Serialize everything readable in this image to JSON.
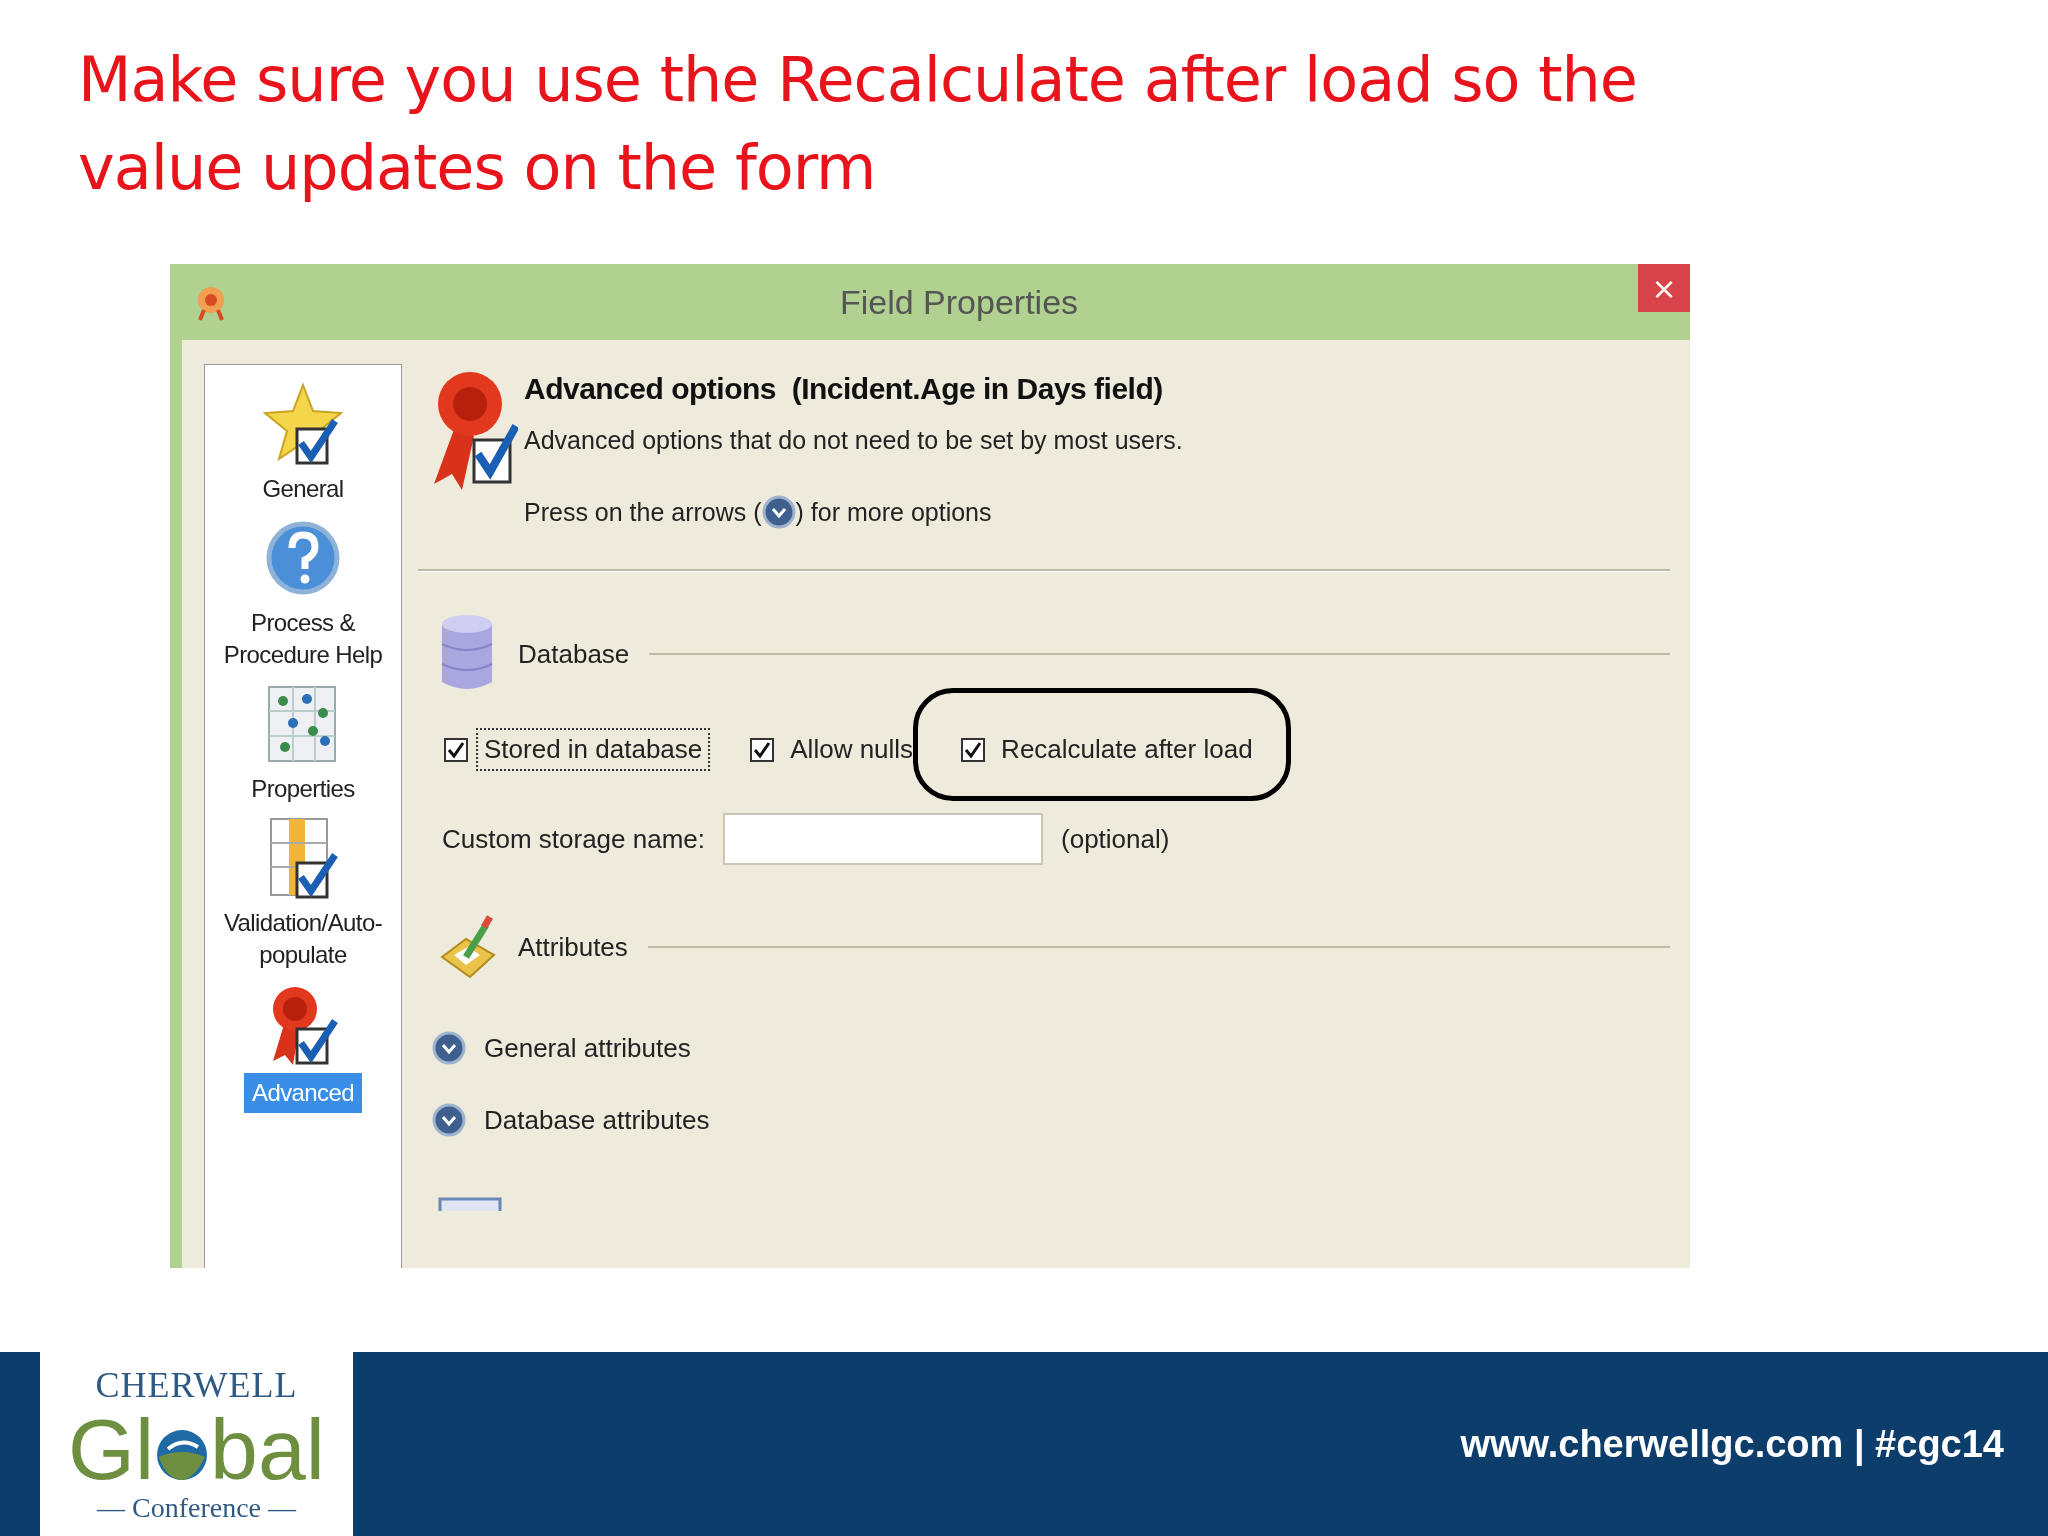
{
  "slide_title": "Make sure you use the Recalculate after load so the value updates on the form",
  "window": {
    "title": "Field Properties",
    "close": "×"
  },
  "sidebar": {
    "items": [
      {
        "kind": "star",
        "label": "General",
        "selected": false
      },
      {
        "kind": "help",
        "label": "Process & Procedure Help",
        "selected": false
      },
      {
        "kind": "grid",
        "label": "Properties",
        "selected": false
      },
      {
        "kind": "table",
        "label": "Validation/Auto-populate",
        "selected": false
      },
      {
        "kind": "ribbon",
        "label": "Advanced",
        "selected": true
      }
    ]
  },
  "header": {
    "title": "Advanced options  (Incident.Age in Days field)",
    "description": "Advanced options that do not need to be set by most users.",
    "hint_before": "Press on the arrows (",
    "hint_after": ") for more options"
  },
  "database": {
    "title": "Database",
    "options": [
      {
        "label": "Stored in database",
        "checked": true,
        "focused": true,
        "circled": false
      },
      {
        "label": "Allow nulls",
        "checked": true,
        "focused": false,
        "circled": false
      },
      {
        "label": "Recalculate after load",
        "checked": true,
        "focused": false,
        "circled": true
      }
    ],
    "storage_label": "Custom storage name:",
    "storage_note": "(optional)"
  },
  "attributes": {
    "title": "Attributes",
    "groups": [
      {
        "label": "General attributes",
        "expanded": false
      },
      {
        "label": "Database attributes",
        "expanded": false
      }
    ]
  },
  "footer": {
    "logo": {
      "top": "CHERWELL",
      "left": "Gl",
      "right": "bal",
      "bottom": "— Conference —"
    },
    "text": "www.cherwellgc.com | #cgc14"
  }
}
